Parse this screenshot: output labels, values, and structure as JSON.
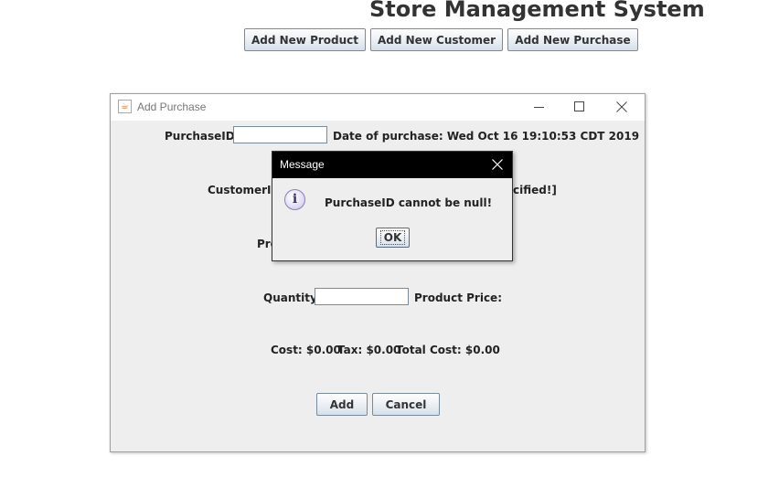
{
  "app": {
    "title": "Store Management System",
    "buttons": {
      "add_product": "Add New Product",
      "add_customer": "Add New Customer",
      "add_purchase": "Add New Purchase"
    }
  },
  "purchase_window": {
    "title": "Add Purchase",
    "purchase_id_label": "PurchaseID",
    "purchase_id_value": "",
    "date_label": "Date of purchase: Wed Oct 16 19:10:53 CDT 2019",
    "customer_id_label": "CustomerID",
    "customer_status_partial": "cified!]",
    "product_label_partial": "Pro",
    "quantity_label": "Quantity",
    "quantity_value": "",
    "product_price_label": "Product Price:",
    "cost_text": "Cost: $0.00",
    "tax_text": "Tax: $0.00",
    "total_cost_text": "Total Cost: $0.00",
    "add_button": "Add",
    "cancel_button": "Cancel"
  },
  "message_dialog": {
    "title": "Message",
    "text": "PurchaseID cannot be null!",
    "ok_button": "OK"
  },
  "icons": {
    "window_app": "java-icon",
    "dialog": "info-icon"
  }
}
